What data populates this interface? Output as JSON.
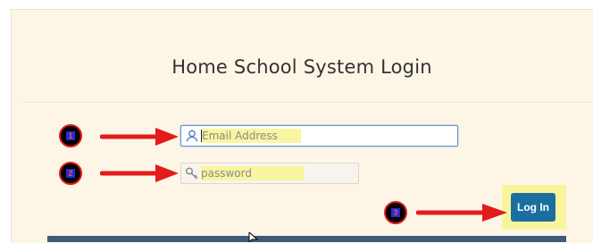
{
  "login": {
    "title": "Home School System Login",
    "email_placeholder": "Email Address",
    "password_placeholder": "password",
    "login_label": "Log In"
  },
  "annotations": {
    "step1": "1",
    "step2": "2",
    "step3": "3"
  },
  "icons": {
    "email": "user-icon",
    "password": "key-icon"
  },
  "colors": {
    "background": "#fdf6e6",
    "login_button": "#1a6fa0",
    "highlight": "#f9f59c",
    "arrow": "#e31b1b",
    "badge_text_bg": "#1f2ed8",
    "footer_bar": "#3f5b78"
  }
}
